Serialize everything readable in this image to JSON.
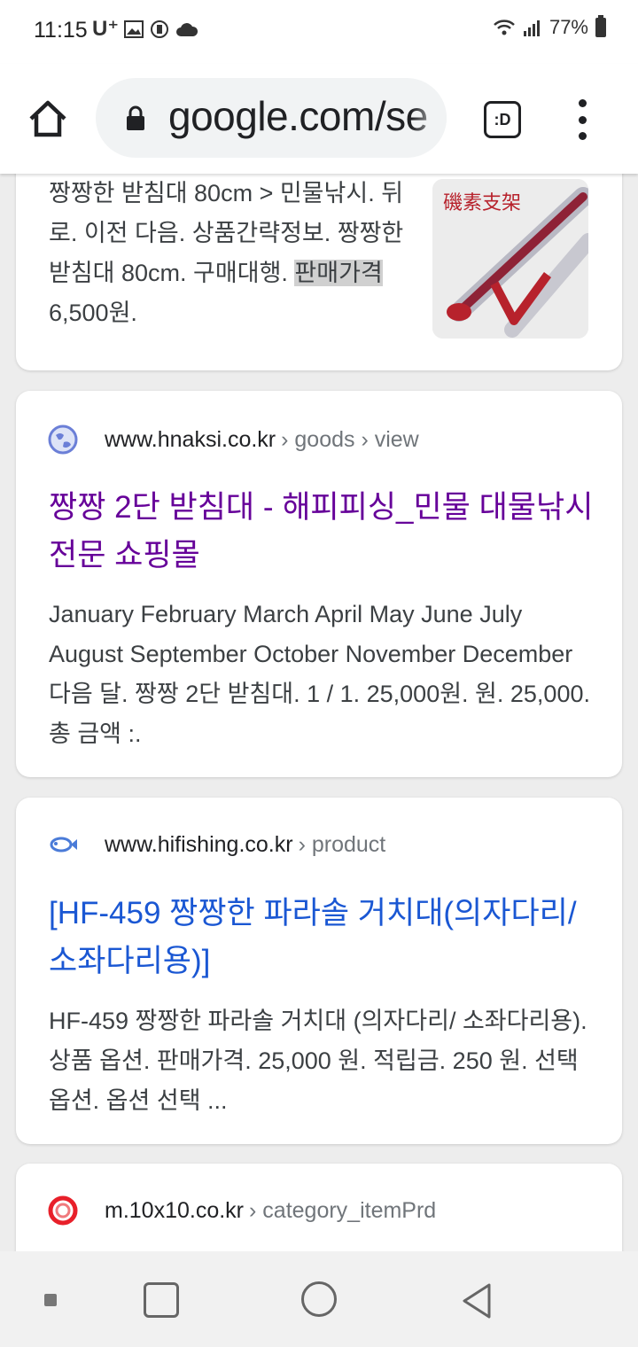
{
  "status": {
    "time": "11:15",
    "carrier": "U⁺",
    "battery": "77%"
  },
  "browser": {
    "url": "google.com/se",
    "tabs_label": ":D"
  },
  "results": [
    {
      "snippet_part1": "짱짱한 받침대 80cm > 민물낚시. 뒤로. 이전 다음. 상품간략정보. 짱짱한 받침대 80cm. 구매대행. ",
      "snippet_highlight": "판매가격",
      "snippet_part2": " 6,500원.",
      "thumbnail_text": "磯素支架"
    },
    {
      "domain": "www.hnaksi.co.kr",
      "path": "› goods › view",
      "title": "짱짱 2단 받침대 - 해피피싱_민물 대물낚시 전문 쇼핑몰",
      "snippet": "January February March April May June July August September October November December 다음 달. 짱짱 2단 받침대. 1 / 1. 25,000원. 원. 25,000. 총 금액 :."
    },
    {
      "domain": "www.hifishing.co.kr",
      "path": "› product",
      "title": "[HF-459 짱짱한 파라솔 거치대(의자다리/소좌다리용)]",
      "snippet": "HF-459 짱짱한 파라솔 거치대 (의자다리/ 소좌다리용). 상품 옵션. 판매가격. 25,000 원. 적립금. 250 원. 선택옵션. 옵션 선택 ..."
    },
    {
      "domain": "m.10x10.co.kr",
      "path": "› category_itemPrd"
    }
  ]
}
